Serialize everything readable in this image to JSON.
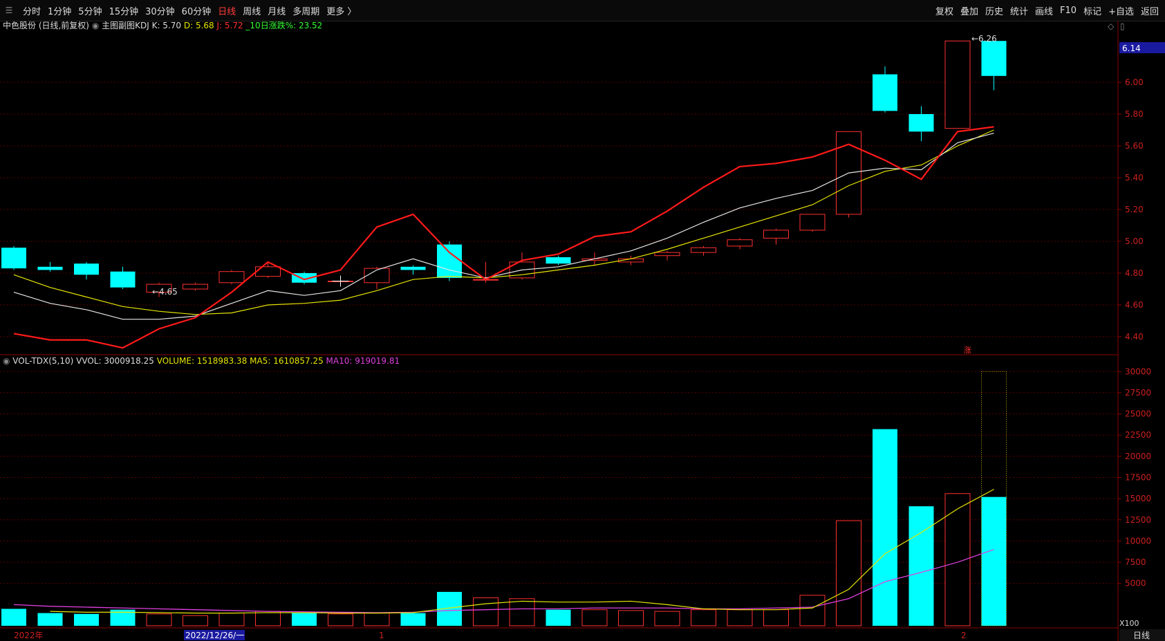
{
  "toolbar": {
    "periods": [
      "分时",
      "1分钟",
      "5分钟",
      "15分钟",
      "30分钟",
      "60分钟",
      "日线",
      "周线",
      "月线",
      "多周期",
      "更多 〉"
    ],
    "active_period": "日线",
    "right_buttons": [
      "复权",
      "叠加",
      "历史",
      "统计",
      "画线",
      "F10",
      "标记",
      "+自选",
      "返回"
    ]
  },
  "header": {
    "stock": "中色股份 (日线,前复权)",
    "indicator": "主图副图KDJ",
    "k_label": "K: 5.70",
    "d_label": "D: 5.68",
    "j_label": "J: 5.72",
    "rise_label": "_10日涨跌%: 23.52"
  },
  "vol_header": {
    "name": "VOL-TDX(5,10)",
    "vvol": "VVOL: 3000918.25",
    "volume": "VOLUME: 1518983.38",
    "ma5": "MA5: 1610857.25",
    "ma10": "MA10: 919019.81"
  },
  "annotations": {
    "low_marker": "4.65",
    "high_marker": "6.26",
    "rise_char": "涨",
    "price_tag": "6.14",
    "unit_tag": "X100",
    "period_tag": "日线"
  },
  "axis_dates": [
    "2022年",
    "2022/12/26/一",
    "1",
    "2"
  ],
  "colors": {
    "up": "#ff3030",
    "down": "#00ffff",
    "k": "#ff1a1a",
    "d": "#e6e6e6",
    "j": "#e6e600",
    "ma10": "#e040e0",
    "grid": "#5a0000"
  },
  "chart_data": [
    {
      "type": "candlestick",
      "ylim": [
        4.3,
        6.3
      ],
      "y_ticks": [
        4.4,
        4.6,
        4.8,
        5.0,
        5.2,
        5.4,
        5.6,
        5.8,
        6.0
      ],
      "candles": [
        {
          "o": 4.96,
          "c": 4.83,
          "h": 4.97,
          "l": 4.82
        },
        {
          "o": 4.84,
          "c": 4.82,
          "h": 4.87,
          "l": 4.81
        },
        {
          "o": 4.86,
          "c": 4.79,
          "h": 4.87,
          "l": 4.76
        },
        {
          "o": 4.81,
          "c": 4.71,
          "h": 4.84,
          "l": 4.7
        },
        {
          "o": 4.68,
          "c": 4.73,
          "h": 4.74,
          "l": 4.65
        },
        {
          "o": 4.7,
          "c": 4.73,
          "h": 4.74,
          "l": 4.69
        },
        {
          "o": 4.74,
          "c": 4.81,
          "h": 4.82,
          "l": 4.73
        },
        {
          "o": 4.78,
          "c": 4.84,
          "h": 4.87,
          "l": 4.77
        },
        {
          "o": 4.8,
          "c": 4.74,
          "h": 4.81,
          "l": 4.73
        },
        {
          "o": 4.75,
          "c": 4.75,
          "h": 4.76,
          "l": 4.72
        },
        {
          "o": 4.74,
          "c": 4.83,
          "h": 4.84,
          "l": 4.7
        },
        {
          "o": 4.84,
          "c": 4.82,
          "h": 4.85,
          "l": 4.79
        },
        {
          "o": 4.98,
          "c": 4.77,
          "h": 5.0,
          "l": 4.75
        },
        {
          "o": 4.76,
          "c": 4.76,
          "h": 4.87,
          "l": 4.74
        },
        {
          "o": 4.77,
          "c": 4.87,
          "h": 4.93,
          "l": 4.76
        },
        {
          "o": 4.9,
          "c": 4.86,
          "h": 4.91,
          "l": 4.85
        },
        {
          "o": 4.88,
          "c": 4.89,
          "h": 4.93,
          "l": 4.85
        },
        {
          "o": 4.87,
          "c": 4.89,
          "h": 4.91,
          "l": 4.85
        },
        {
          "o": 4.91,
          "c": 4.93,
          "h": 4.94,
          "l": 4.88
        },
        {
          "o": 4.93,
          "c": 4.96,
          "h": 4.97,
          "l": 4.91
        },
        {
          "o": 4.97,
          "c": 5.01,
          "h": 5.02,
          "l": 4.95
        },
        {
          "o": 5.02,
          "c": 5.07,
          "h": 5.08,
          "l": 4.98
        },
        {
          "o": 5.07,
          "c": 5.17,
          "h": 5.17,
          "l": 5.06
        },
        {
          "o": 5.17,
          "c": 5.69,
          "h": 5.69,
          "l": 5.15
        },
        {
          "o": 6.05,
          "c": 5.82,
          "h": 6.1,
          "l": 5.81
        },
        {
          "o": 5.8,
          "c": 5.69,
          "h": 5.85,
          "l": 5.63
        },
        {
          "o": 5.71,
          "c": 6.26,
          "h": 6.26,
          "l": 5.71
        },
        {
          "o": 6.26,
          "c": 6.04,
          "h": 6.26,
          "l": 5.95
        }
      ],
      "k_line": [
        null,
        4.42,
        4.38,
        4.38,
        4.33,
        4.45,
        4.52,
        4.68,
        4.87,
        4.76,
        4.82,
        5.09,
        5.17,
        4.93,
        4.76,
        4.88,
        4.92,
        5.03,
        5.06,
        5.19,
        5.34,
        5.47,
        5.49,
        5.53,
        5.61,
        5.51,
        5.39,
        5.69,
        5.72
      ],
      "d_line": [
        null,
        4.68,
        4.61,
        4.57,
        4.51,
        4.51,
        4.53,
        4.61,
        4.69,
        4.66,
        4.69,
        4.82,
        4.89,
        4.82,
        4.77,
        4.82,
        4.84,
        4.89,
        4.94,
        5.02,
        5.12,
        5.21,
        5.27,
        5.32,
        5.43,
        5.46,
        5.45,
        5.62,
        5.68
      ],
      "j_line": [
        null,
        4.79,
        4.71,
        4.65,
        4.59,
        4.56,
        4.54,
        4.55,
        4.6,
        4.61,
        4.63,
        4.69,
        4.76,
        4.78,
        4.77,
        4.79,
        4.82,
        4.85,
        4.89,
        4.95,
        5.02,
        5.09,
        5.16,
        5.23,
        5.35,
        5.44,
        5.48,
        5.6,
        5.7
      ]
    },
    {
      "type": "bar",
      "name": "VOL",
      "ylim": [
        0,
        31000
      ],
      "y_ticks": [
        5000,
        7500,
        10000,
        12500,
        15000,
        17500,
        20000,
        22500,
        25000,
        27500,
        30000
      ],
      "values": [
        2000,
        1500,
        1400,
        1900,
        1400,
        1200,
        1500,
        1700,
        1500,
        1400,
        1500,
        1500,
        4000,
        3300,
        3200,
        1900,
        1900,
        1800,
        1700,
        1900,
        1900,
        1900,
        3600,
        12400,
        23200,
        14100,
        15600,
        15200
      ],
      "up": [
        false,
        false,
        false,
        false,
        true,
        true,
        true,
        true,
        false,
        true,
        true,
        false,
        false,
        true,
        true,
        false,
        true,
        true,
        true,
        true,
        true,
        true,
        true,
        true,
        false,
        false,
        true,
        false
      ],
      "vvol_value": 30000,
      "ma5": [
        null,
        1700,
        1600,
        1600,
        1550,
        1500,
        1500,
        1550,
        1550,
        1500,
        1500,
        1550,
        2100,
        2600,
        2900,
        2800,
        2800,
        2900,
        2500,
        2000,
        1900,
        1900,
        2100,
        4300,
        8500,
        11000,
        13800,
        16100
      ],
      "ma10": [
        2500,
        2300,
        2200,
        2100,
        2000,
        1900,
        1800,
        1700,
        1650,
        1600,
        1550,
        1600,
        1800,
        1900,
        2000,
        2000,
        2100,
        2100,
        2100,
        2000,
        2000,
        2100,
        2200,
        3200,
        5200,
        6300,
        7500,
        9000
      ]
    }
  ]
}
